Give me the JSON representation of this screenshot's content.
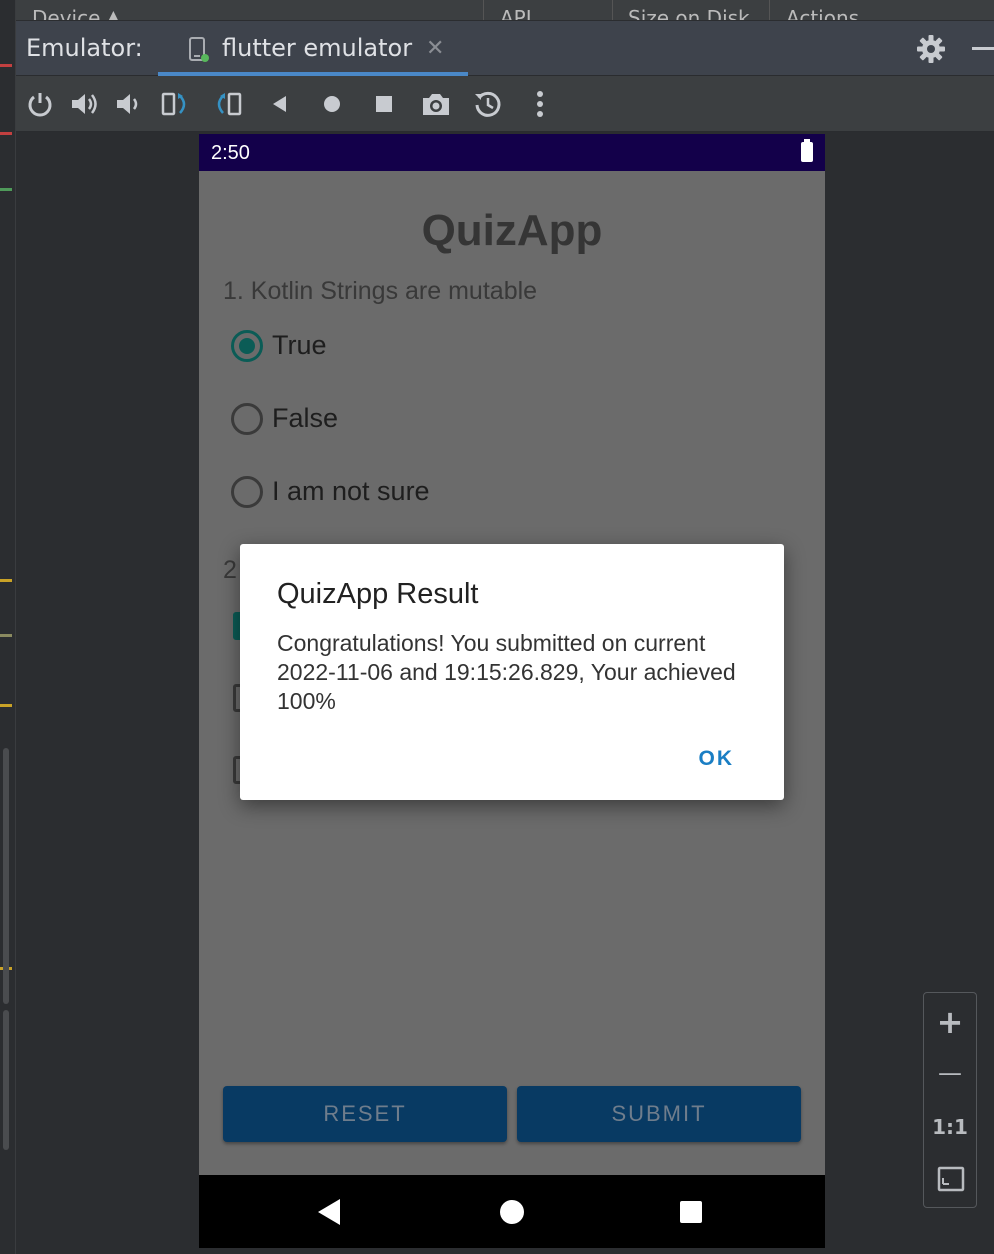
{
  "device_manager": {
    "columns": [
      "Device",
      "API",
      "Size on Disk",
      "Actions"
    ]
  },
  "emulator_bar": {
    "label": "Emulator:",
    "tab_title": "flutter emulator",
    "close_glyph": "✕"
  },
  "toolbar": {
    "icons": [
      "power-icon",
      "volume-up-icon",
      "volume-down-icon",
      "rotate-left-icon",
      "rotate-right-icon",
      "back-icon",
      "home-icon",
      "overview-icon",
      "screenshot-icon",
      "snapshot-icon",
      "more-icon"
    ]
  },
  "phone": {
    "status_time": "2:50",
    "app_title": "QuizApp",
    "question1": "1. Kotlin Strings are mutable",
    "options": [
      {
        "label": "True",
        "selected": true
      },
      {
        "label": "False",
        "selected": false
      },
      {
        "label": "I am not sure",
        "selected": false
      }
    ],
    "question2_fragment": "2",
    "reset_label": "RESET",
    "submit_label": "SUBMIT"
  },
  "dialog": {
    "title": "QuizApp Result",
    "message": "Congratulations! You submitted on current 2022-11-06 and 19:15:26.829, Your achieved 100%",
    "ok_label": "OK"
  },
  "zoom": {
    "plus": "+",
    "minus": "—",
    "one_to_one": "1:1"
  },
  "colors": {
    "accent": "#0b5c56",
    "status_bar": "#13004a",
    "button": "#083a63",
    "link": "#1a7ec4",
    "tab_underline": "#4a88c7"
  }
}
